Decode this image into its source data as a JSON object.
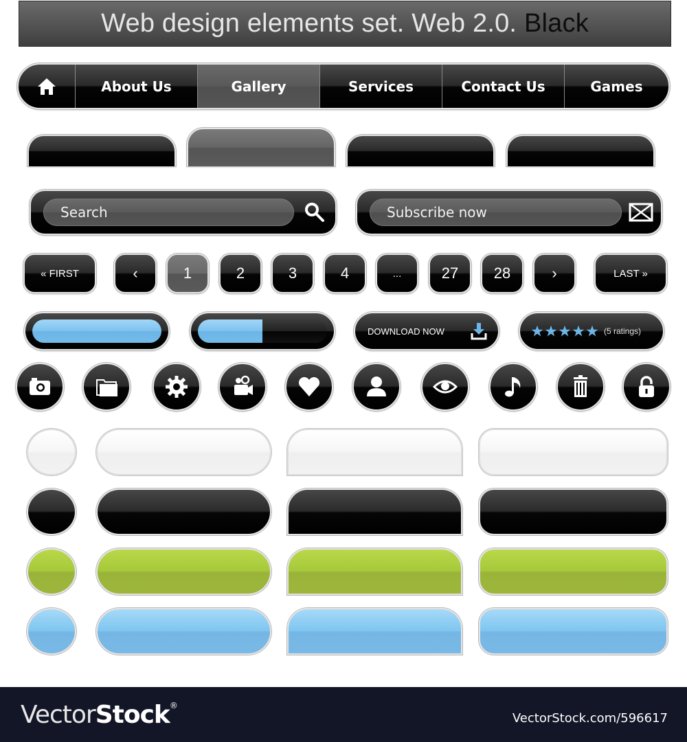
{
  "title": {
    "main": "Web design elements set. Web 2.0.",
    "accent": "Black"
  },
  "nav": {
    "home_icon": "home-icon",
    "items": [
      {
        "label": "About Us"
      },
      {
        "label": "Gallery",
        "active": true
      },
      {
        "label": "Services"
      },
      {
        "label": "Contact Us"
      },
      {
        "label": "Games"
      }
    ]
  },
  "tabs": {
    "count": 4,
    "active_index": 1
  },
  "search": {
    "placeholder": "Search",
    "icon": "search-icon"
  },
  "subscribe": {
    "placeholder": "Subscribe now",
    "icon": "envelope-icon"
  },
  "pagination": {
    "first": "« FIRST",
    "prev": "‹",
    "pages": [
      "1",
      "2",
      "3",
      "4",
      "...",
      "27",
      "28"
    ],
    "current": "1",
    "next": "›",
    "last": "LAST »"
  },
  "progress": {
    "full_fraction": 1.0,
    "partial_fraction": 0.5
  },
  "download": {
    "label": "DOWNLOAD NOW",
    "icon": "download-icon"
  },
  "rating": {
    "stars": 5,
    "max": 5,
    "label": "(5 ratings)",
    "star_color": "#6db5e6"
  },
  "icons": [
    "camera-icon",
    "folder-icon",
    "gear-icon",
    "video-camera-icon",
    "heart-icon",
    "user-icon",
    "eye-icon",
    "music-note-icon",
    "trash-icon",
    "lock-icon"
  ],
  "color_sets": [
    "white",
    "black",
    "green",
    "blue"
  ],
  "colors": {
    "green": "#a6c93a",
    "blue": "#7fc6f0",
    "black": "#000000",
    "white": "#f6f6f6"
  },
  "footer": {
    "logo_thin": "Vector",
    "logo_bold": "Stock",
    "logo_mark": "®",
    "url": "VectorStock.com/596617"
  }
}
